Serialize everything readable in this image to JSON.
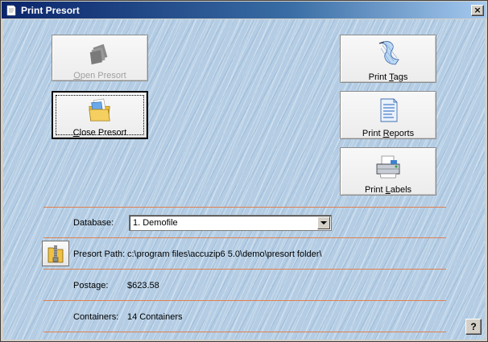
{
  "window": {
    "title": "Print Presort",
    "close_glyph": "×"
  },
  "buttons": {
    "open_presort": {
      "prefix": "",
      "hotkey": "O",
      "suffix": "pen Presort",
      "icon": "stack-gray-icon",
      "enabled": false
    },
    "close_presort": {
      "prefix": "",
      "hotkey": "C",
      "suffix": "lose Presort",
      "icon": "folder-docs-icon",
      "enabled": true
    },
    "print_tags": {
      "prefix": "Print ",
      "hotkey": "T",
      "suffix": "ags",
      "icon": "tag-sheet-icon",
      "enabled": true
    },
    "print_reports": {
      "prefix": "Print ",
      "hotkey": "R",
      "suffix": "eports",
      "icon": "report-document-icon",
      "enabled": true
    },
    "print_labels": {
      "prefix": "Print ",
      "hotkey": "L",
      "suffix": "abels",
      "icon": "printer-icon",
      "enabled": true
    }
  },
  "fields": {
    "database_label": "Database:",
    "database_value": "1. Demofile",
    "presort_path_label": "Presort Path:",
    "presort_path_value": "c:\\program files\\accuzip6 5.0\\demo\\presort folder\\",
    "postage_label": "Postage:",
    "postage_value": "$623.58",
    "containers_label": "Containers:",
    "containers_value": "14 Containers"
  },
  "help": {
    "label": "?"
  },
  "colors": {
    "title_gradient_start": "#0a246a",
    "separator": "#e08050",
    "background_pattern": "#b4cde4"
  }
}
